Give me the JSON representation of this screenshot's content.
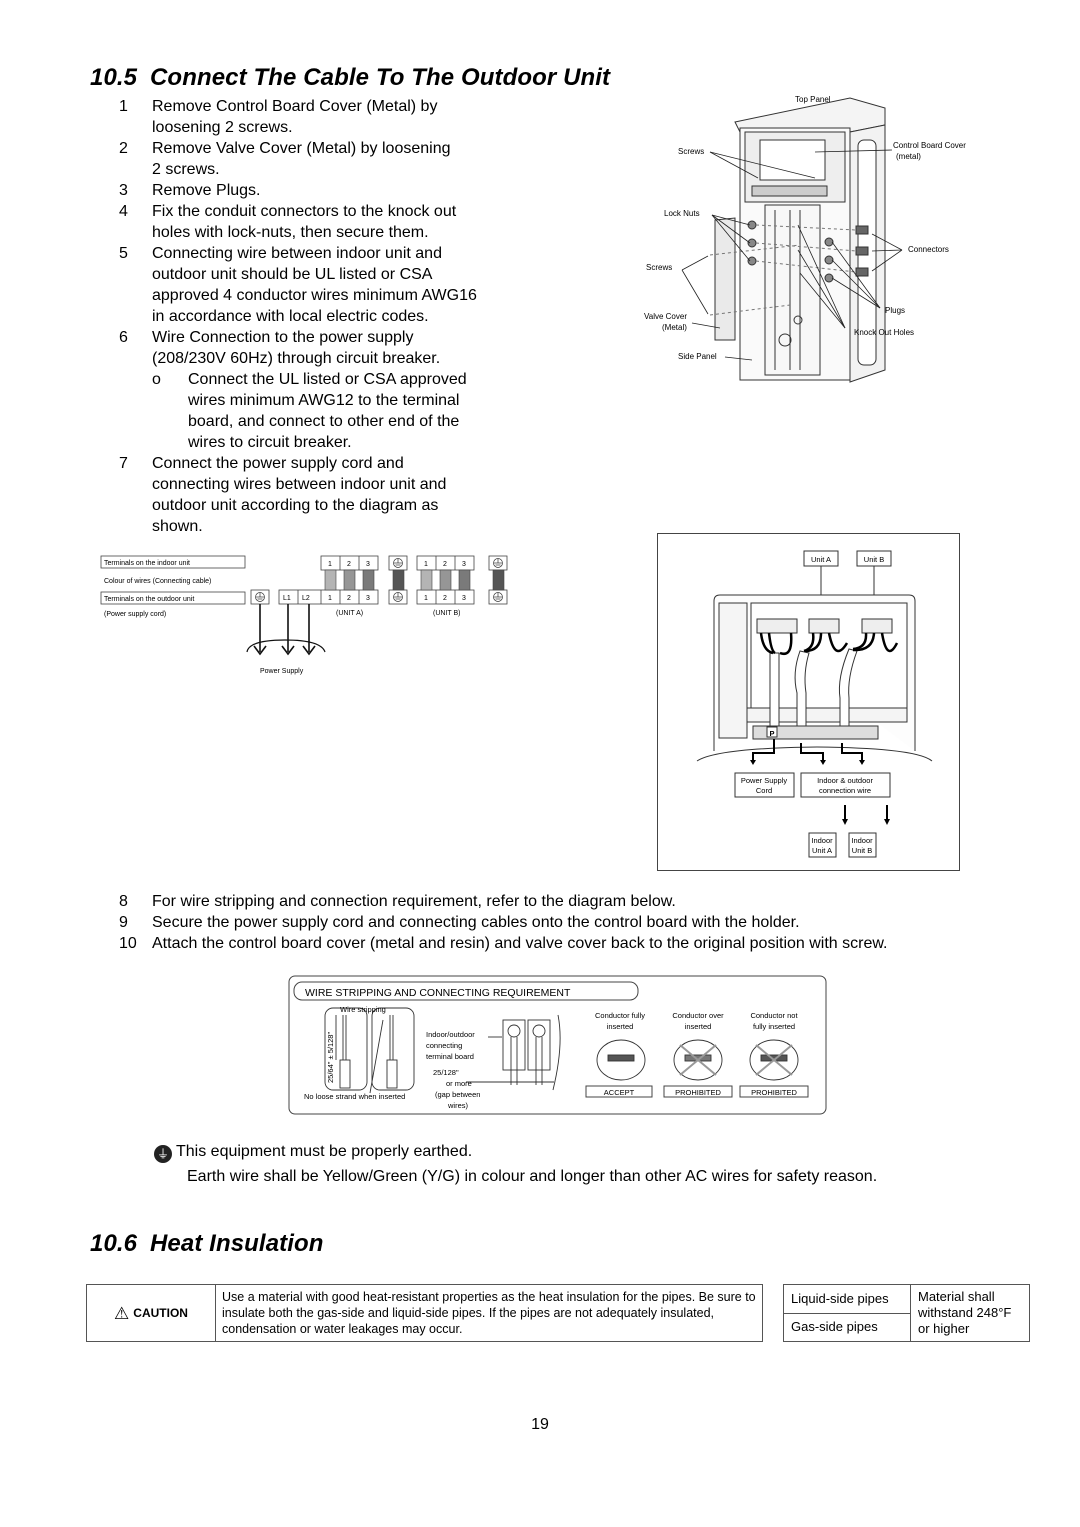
{
  "section_10_5": {
    "number": "10.5",
    "title": "Connect The Cable To The Outdoor Unit",
    "steps": [
      {
        "n": "1",
        "lines": [
          "Remove Control Board Cover (Metal) by",
          "loosening 2 screws."
        ]
      },
      {
        "n": "2",
        "lines": [
          "Remove Valve Cover (Metal) by loosening",
          "2 screws."
        ]
      },
      {
        "n": "3",
        "lines": [
          "Remove Plugs."
        ]
      },
      {
        "n": "4",
        "lines": [
          "Fix the conduit connectors to the knock out",
          "holes with lock-nuts, then secure them."
        ]
      },
      {
        "n": "5",
        "lines": [
          "Connecting wire between indoor unit and",
          "outdoor unit should be UL listed or CSA",
          "approved 4 conductor wires minimum AWG16",
          "in accordance with local electric codes."
        ]
      },
      {
        "n": "6",
        "lines": [
          "Wire Connection to the power supply",
          "(208/230V 60Hz) through circuit breaker."
        ],
        "sub": {
          "bullet": "o",
          "lines": [
            "Connect the UL listed or CSA approved",
            "wires minimum AWG12 to the terminal",
            "board, and connect to other end of the",
            "wires to circuit breaker."
          ]
        }
      },
      {
        "n": "7",
        "lines": [
          "Connect the power supply cord and",
          "connecting wires between indoor unit and",
          "outdoor unit according to the diagram as",
          "shown."
        ]
      }
    ],
    "steps_wide": [
      {
        "n": "8",
        "text": "For wire stripping and connection requirement, refer to the diagram below."
      },
      {
        "n": "9",
        "text": "Secure the power supply cord and connecting cables onto the control board with the holder."
      },
      {
        "n": "10",
        "text": "Attach the control board cover (metal and resin) and valve cover back to the original position with screw."
      }
    ]
  },
  "figure_unit": {
    "labels": {
      "top_panel": "Top Panel",
      "screws_top": "Screws",
      "control_board_cover_1": "Control Board Cover",
      "control_board_cover_2": "(metal)",
      "lock_nuts": "Lock Nuts",
      "connectors": "Connectors",
      "screws_side": "Screws",
      "plugs": "Plugs",
      "valve_cover_1": "Valve Cover",
      "valve_cover_2": "(Metal)",
      "knock_out_holes": "Knock Out Holes",
      "side_panel": "Side Panel"
    }
  },
  "figure_terminals": {
    "row_indoor": "Terminals on the indoor unit",
    "row_colour": "Colour of wires (Connecting cable)",
    "row_outdoor": "Terminals on the outdoor unit",
    "row_power": "(Power supply cord)",
    "indoor_a": [
      "1",
      "2",
      "3"
    ],
    "indoor_b": [
      "1",
      "2",
      "3"
    ],
    "outdoor_power": [
      "L1",
      "L2"
    ],
    "outdoor_a": [
      "1",
      "2",
      "3"
    ],
    "outdoor_b": [
      "1",
      "2",
      "3"
    ],
    "unit_a": "(UNIT A)",
    "unit_b": "(UNIT B)",
    "power_supply": "Power Supply",
    "wire_colors": [
      "#b4b4b4",
      "#969696",
      "#7a7a7a",
      "#555555"
    ]
  },
  "figure_board": {
    "unit_a": "Unit A",
    "unit_b": "Unit B",
    "p_label": "P",
    "power_cord_1": "Power Supply",
    "power_cord_2": "Cord",
    "conn_wire_1": "Indoor & outdoor",
    "conn_wire_2": "connection wire",
    "indoor_a_1": "Indoor",
    "indoor_a_2": "Unit A",
    "indoor_b_1": "Indoor",
    "indoor_b_2": "Unit B"
  },
  "figure_stripping": {
    "title": "WIRE STRIPPING AND CONNECTING REQUIREMENT",
    "wire_stripping": "Wire stripping",
    "strip_length": "25/64\" ± 5/128\"",
    "no_loose": "No loose strand when inserted",
    "terminal_1": "Indoor/outdoor",
    "terminal_2": "connecting",
    "terminal_3": "terminal board",
    "gap_1": "25/128\"",
    "gap_2": "or more",
    "gap_3": "(gap between",
    "gap_4": "wires)",
    "cases": [
      {
        "title_1": "Conductor fully",
        "title_2": "inserted",
        "verdict": "ACCEPT"
      },
      {
        "title_1": "Conductor over",
        "title_2": "inserted",
        "verdict": "PROHIBITED"
      },
      {
        "title_1": "Conductor not",
        "title_2": "fully inserted",
        "verdict": "PROHIBITED"
      }
    ]
  },
  "earth_note": {
    "line1": "This equipment must be properly earthed.",
    "line2": "Earth wire shall be Yellow/Green (Y/G) in colour and longer than other AC wires for safety reason."
  },
  "section_10_6": {
    "number": "10.6",
    "title": "Heat Insulation",
    "caution_label": "CAUTION",
    "caution_text": "Use a material with good heat-resistant properties as the heat insulation for the pipes. Be sure to insulate both the gas-side and liquid-side pipes. If the pipes are not adequately insulated, condensation or water leakages may occur.",
    "pipes": [
      "Liquid-side pipes",
      "Gas-side pipes"
    ],
    "requirement": "Material shall withstand 248°F or higher"
  },
  "page_number": "19"
}
